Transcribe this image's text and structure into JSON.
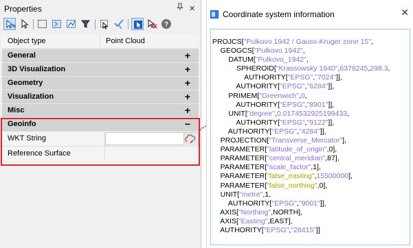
{
  "properties_panel": {
    "title": "Properties",
    "pin_glyph": "ᵖ",
    "close_glyph": "✕",
    "grid_header": {
      "col1": "Object type",
      "col2": "Point Cloud"
    },
    "categories": [
      {
        "label": "General",
        "state": "+"
      },
      {
        "label": "3D Visualization",
        "state": "+"
      },
      {
        "label": "Geometry",
        "state": "+"
      },
      {
        "label": "Visualization",
        "state": "+"
      },
      {
        "label": "Misc",
        "state": "+"
      },
      {
        "label": "Geoinfo",
        "state": "−"
      }
    ],
    "geoinfo_rows": [
      {
        "label": "WKT String",
        "value": ""
      },
      {
        "label": "Reference Surface",
        "value": ""
      }
    ]
  },
  "coordinate_window": {
    "title": "Coordinate system information",
    "close_glyph": "✕",
    "wkt_lines": [
      [
        [
          "t",
          "PROJCS["
        ],
        [
          "s",
          "\"Pulkovo 1942 / Gauss-Kruger zone 15\""
        ],
        [
          "t",
          ","
        ]
      ],
      [
        [
          "t",
          "    GEOGCS["
        ],
        [
          "s",
          "\"Pulkovo 1942\""
        ],
        [
          "t",
          ","
        ]
      ],
      [
        [
          "t",
          "        DATUM["
        ],
        [
          "s",
          "\"Pulkovo_1942\""
        ],
        [
          "t",
          ","
        ]
      ],
      [
        [
          "t",
          "            SPHEROID["
        ],
        [
          "s",
          "\"Krassowsky 1940\""
        ],
        [
          "t",
          ","
        ],
        [
          "s",
          "6378245"
        ],
        [
          "t",
          ","
        ],
        [
          "s",
          "298.3"
        ],
        [
          "t",
          ","
        ]
      ],
      [
        [
          "t",
          "                AUTHORITY["
        ],
        [
          "s",
          "\"EPSG\""
        ],
        [
          "t",
          ","
        ],
        [
          "s",
          "\"7024\""
        ],
        [
          "t",
          "]],"
        ]
      ],
      [
        [
          "t",
          "            AUTHORITY["
        ],
        [
          "s",
          "\"EPSG\""
        ],
        [
          "t",
          ","
        ],
        [
          "s",
          "\"6284\""
        ],
        [
          "t",
          "]],"
        ]
      ],
      [
        [
          "t",
          "        PRIMEM["
        ],
        [
          "s",
          "\"Greenwich\""
        ],
        [
          "t",
          ","
        ],
        [
          "s",
          "0"
        ],
        [
          "t",
          ","
        ]
      ],
      [
        [
          "t",
          "            AUTHORITY["
        ],
        [
          "s",
          "\"EPSG\""
        ],
        [
          "t",
          ","
        ],
        [
          "s",
          "\"8901\""
        ],
        [
          "t",
          "]],"
        ]
      ],
      [
        [
          "t",
          "        UNIT["
        ],
        [
          "s",
          "\"degree\""
        ],
        [
          "t",
          ","
        ],
        [
          "s",
          "0.0174532925199433"
        ],
        [
          "t",
          ","
        ]
      ],
      [
        [
          "t",
          "            AUTHORITY["
        ],
        [
          "s",
          "\"EPSG\""
        ],
        [
          "t",
          ","
        ],
        [
          "s",
          "\"9122\""
        ],
        [
          "t",
          "]],"
        ]
      ],
      [
        [
          "t",
          "        AUTHORITY["
        ],
        [
          "s",
          "\"EPSG\""
        ],
        [
          "t",
          ","
        ],
        [
          "s",
          "\"4284\""
        ],
        [
          "t",
          "]],"
        ]
      ],
      [
        [
          "t",
          "    PROJECTION["
        ],
        [
          "s",
          "\"Transverse_Mercator\""
        ],
        [
          "t",
          "],"
        ]
      ],
      [
        [
          "t",
          "    PARAMETER["
        ],
        [
          "s",
          "\"latitude_of_origin\""
        ],
        [
          "t",
          ",0],"
        ]
      ],
      [
        [
          "t",
          "    PARAMETER["
        ],
        [
          "s",
          "\"central_meridian\""
        ],
        [
          "t",
          ",87],"
        ]
      ],
      [
        [
          "t",
          "    PARAMETER["
        ],
        [
          "s",
          "\"scale_factor\""
        ],
        [
          "t",
          ",1],"
        ]
      ],
      [
        [
          "t",
          "    PARAMETER["
        ],
        [
          "g",
          "\"false_easting\""
        ],
        [
          "t",
          ","
        ],
        [
          "s",
          "15500000"
        ],
        [
          "t",
          "],"
        ]
      ],
      [
        [
          "t",
          "    PARAMETER["
        ],
        [
          "g",
          "\"false_northing\""
        ],
        [
          "t",
          ",0],"
        ]
      ],
      [
        [
          "t",
          "    UNIT["
        ],
        [
          "s",
          "\"metre\""
        ],
        [
          "t",
          ",1,"
        ]
      ],
      [
        [
          "t",
          "        AUTHORITY["
        ],
        [
          "s",
          "\"EPSG\""
        ],
        [
          "t",
          ","
        ],
        [
          "s",
          "\"9001\""
        ],
        [
          "t",
          "]],"
        ]
      ],
      [
        [
          "t",
          "    AXIS["
        ],
        [
          "s",
          "\"Northing\""
        ],
        [
          "t",
          ",NORTH],"
        ]
      ],
      [
        [
          "t",
          "    AXIS["
        ],
        [
          "s",
          "\"Easting\""
        ],
        [
          "t",
          ",EAST],"
        ]
      ],
      [
        [
          "t",
          "    AUTHORITY["
        ],
        [
          "s",
          "\"EPSG\""
        ],
        [
          "t",
          ","
        ],
        [
          "s",
          "\"28415\""
        ],
        [
          "t",
          "]]"
        ]
      ]
    ]
  },
  "colors": {
    "highlight": "#d9232d",
    "string_literal": "#8b6fc8",
    "param_name": "#b59c00",
    "category_bg": "#d3d3d3"
  },
  "icons": {
    "toolbar": [
      "select-add-icon",
      "pointer-icon",
      "select-window-icon",
      "select-crossing-icon",
      "select-fence-icon",
      "filter-icon",
      "selection-set-icon",
      "edit-check-icon",
      "select-mode-icon",
      "deselect-icon",
      "help-icon"
    ],
    "wkt_button": "cloud-edit-icon",
    "window": "app-window-icon"
  }
}
